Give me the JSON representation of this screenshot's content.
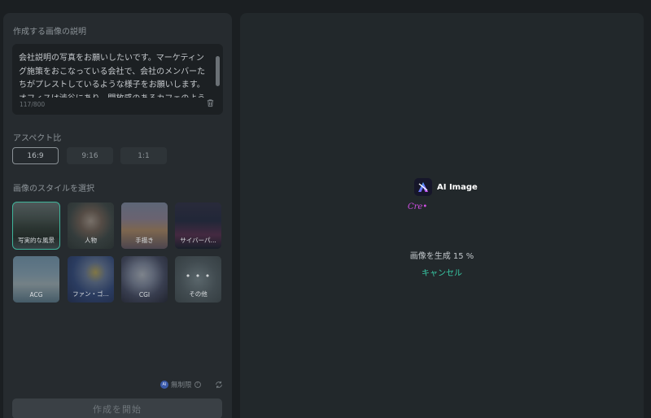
{
  "left": {
    "description_label": "作成する画像の説明",
    "description_text": "会社説明の写真をお願いしたいです。マーケティング施策をおこなっている会社で、会社のメンバーたちがプレストしているような様子をお願いします。オフィスは渋谷にあり、開放感のあるカフェのよう",
    "char_count": "117/800",
    "aspect_label": "アスペクト比",
    "aspect_options": [
      "16:9",
      "9:16",
      "1:1"
    ],
    "aspect_selected": "16:9",
    "style_label": "画像のスタイルを選択",
    "styles": [
      "写実的な風景",
      "人物",
      "手描き",
      "サイバーパ...",
      "ACG",
      "ファン・ゴ...",
      "CGI",
      "その他"
    ],
    "more_dots": "• • •",
    "quota_badge": "AI",
    "quota_text": "無制限",
    "help_glyph": "?",
    "start_button": "作成を開始"
  },
  "right": {
    "app_name": "AI Image",
    "cre_text": "Cre•",
    "progress_text": "画像を生成 15 %",
    "progress_percent": 15,
    "cancel_label": "キャンセル"
  },
  "colors": {
    "accent": "#3fb59b",
    "cancel": "#38c9a5",
    "cre": "#d24fe6"
  }
}
